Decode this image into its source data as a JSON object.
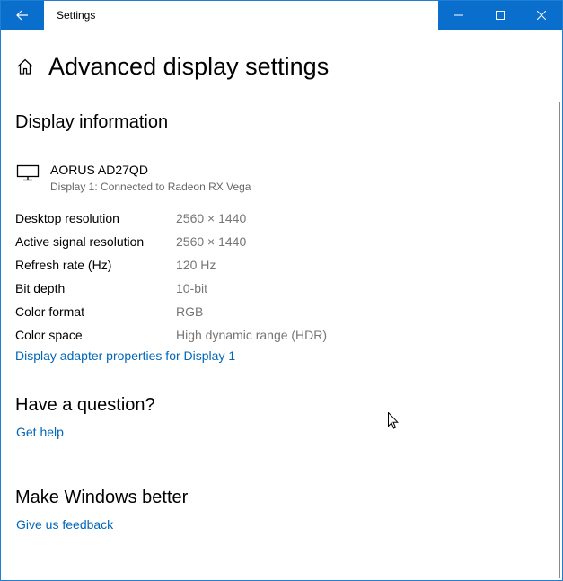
{
  "window": {
    "title": "Settings"
  },
  "icons": {
    "back": "back-arrow-icon",
    "minimize": "minimize-icon",
    "maximize": "maximize-icon",
    "close": "close-icon",
    "home": "home-icon",
    "monitor": "monitor-icon"
  },
  "colors": {
    "accent": "#0a6fcc",
    "link": "#0067b8",
    "secondary_text": "#767676"
  },
  "page": {
    "title": "Advanced display settings"
  },
  "display_info": {
    "heading": "Display information",
    "monitor_name": "AORUS AD27QD",
    "monitor_subtitle": "Display 1: Connected to Radeon RX Vega",
    "rows": [
      {
        "label": "Desktop resolution",
        "value": "2560 × 1440"
      },
      {
        "label": "Active signal resolution",
        "value": "2560 × 1440"
      },
      {
        "label": "Refresh rate (Hz)",
        "value": "120 Hz"
      },
      {
        "label": "Bit depth",
        "value": "10-bit"
      },
      {
        "label": "Color format",
        "value": "RGB"
      },
      {
        "label": "Color space",
        "value": "High dynamic range (HDR)"
      }
    ],
    "adapter_link": "Display adapter properties for Display 1"
  },
  "question": {
    "heading": "Have a question?",
    "link": "Get help"
  },
  "feedback": {
    "heading": "Make Windows better",
    "link": "Give us feedback"
  }
}
